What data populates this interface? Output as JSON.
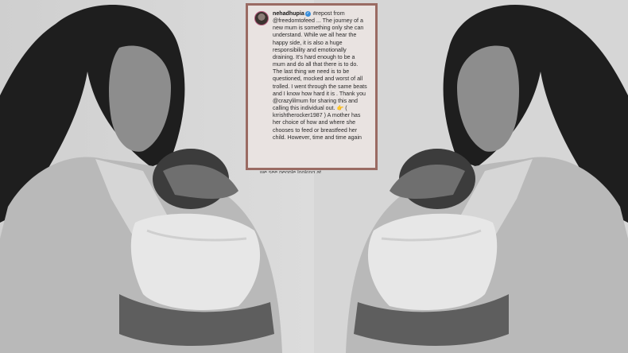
{
  "post": {
    "username": "nehadhupia",
    "caption": " #repost from @freedomtofeed ... The journey of a new mum is something only she can understand. While we all hear the happy side, it is also a huge responsibility and emotionally draining. It's hard enough to be a mum and do all that there is to do. The last thing we need is to be questioned, mocked and worst of all trolled. I went through the same beats and I know how hard it is . Thank you @crazylilmum for sharing this and calling this individual out. 👉 ( krrishtherocker1987 ) A mother has her choice of how and where she chooses to feed or breastfeed her child. However, time and time again",
    "cut_line": "we see people looking at"
  },
  "icons": {
    "verified": "✓"
  },
  "colors": {
    "card_border": "#9a6b63",
    "card_background": "#e9e3e1"
  }
}
